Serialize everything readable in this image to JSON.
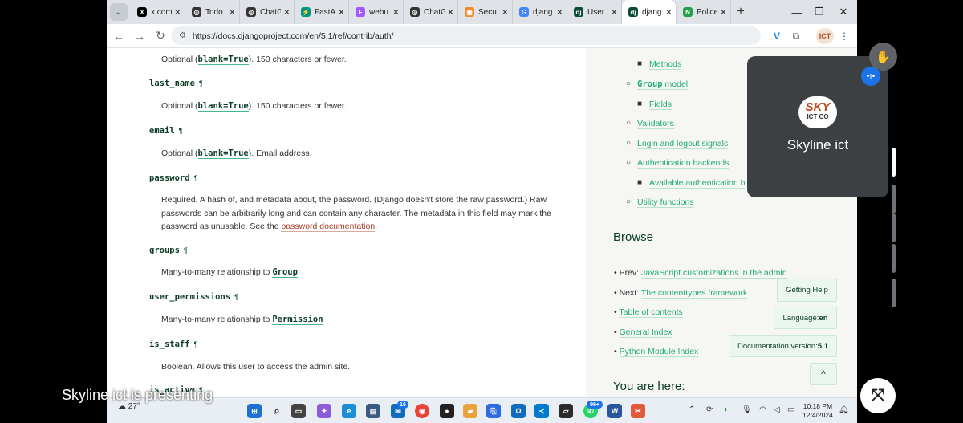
{
  "browser": {
    "tabs": [
      {
        "label": "x.com",
        "fav": "X",
        "color": "#000000"
      },
      {
        "label": "Todo",
        "fav": "◎",
        "color": "#333333"
      },
      {
        "label": "ChatG",
        "fav": "◎",
        "color": "#333333"
      },
      {
        "label": "FastA",
        "fav": "⚡",
        "color": "#009485"
      },
      {
        "label": "webu",
        "fav": "F",
        "color": "#a259ff"
      },
      {
        "label": "ChatG",
        "fav": "◎",
        "color": "#333333"
      },
      {
        "label": "Secu",
        "fav": "▣",
        "color": "#f08a24"
      },
      {
        "label": "djang",
        "fav": "G",
        "color": "#4285f4"
      },
      {
        "label": "User",
        "fav": "dj",
        "color": "#0c4b33"
      },
      {
        "label": "djang",
        "fav": "dj",
        "color": "#0c4b33"
      },
      {
        "label": "Police",
        "fav": "N",
        "color": "#24a148"
      }
    ],
    "active_tab_index": 9,
    "url": "https://docs.djangoproject.com/en/5.1/ref/contrib/auth/"
  },
  "doc": {
    "first_desc_pre": "Optional (",
    "first_desc_code": "blank=True",
    "first_desc_post": "). 150 characters or fewer.",
    "last_name": {
      "name": "last_name",
      "pre": "Optional (",
      "code": "blank=True",
      "post": "). 150 characters or fewer."
    },
    "email": {
      "name": "email",
      "pre": "Optional (",
      "code": "blank=True",
      "post": "). Email address."
    },
    "password": {
      "name": "password",
      "text": "Required. A hash of, and metadata about, the password. (Django doesn't store the raw password.) Raw passwords can be arbitrarily long and can contain any character. The metadata in this field may mark the password as unusable. See the ",
      "link": "password documentation",
      "post": "."
    },
    "groups": {
      "name": "groups",
      "pre": "Many-to-many relationship to ",
      "code": "Group"
    },
    "user_permissions": {
      "name": "user_permissions",
      "pre": "Many-to-many relationship to ",
      "code": "Permission"
    },
    "is_staff": {
      "name": "is_staff",
      "text": "Boolean. Allows this user to access the admin site."
    },
    "is_active": {
      "name": "is_active"
    },
    "pilcrow": "¶"
  },
  "sidebar": {
    "toc": {
      "methods": "Methods",
      "group_model_code": "Group",
      "group_model_text": " model",
      "fields": "Fields",
      "validators": "Validators",
      "login_logout": "Login and logout signals",
      "auth_backends": "Authentication backends",
      "available_backends": "Available authentication b",
      "utility": "Utility functions"
    },
    "browse_title": "Browse",
    "browse": {
      "prev_label": "Prev: ",
      "prev_link": "JavaScript customizations in the admin",
      "next_label": "Next: ",
      "next_link": "The contenttypes framework",
      "toc": "Table of contents",
      "general_index": "General Index",
      "module_index": "Python Module Index"
    },
    "you_are_here": "You are here:",
    "buttons": {
      "getting_help": "Getting Help",
      "language_label": "Language: ",
      "language_value": "en",
      "version_label": "Documentation version: ",
      "version_value": "5.1",
      "back_to_top": "^"
    }
  },
  "taskbar": {
    "weather": "27°",
    "badge_mail": "16",
    "badge_whatsapp": "99+",
    "clock_time": "10:18 PM",
    "clock_date": "12/4/2024"
  },
  "meet": {
    "presenter_name": "Skyline ict",
    "avatar_text": "SKY",
    "avatar_sub": "ICT CO",
    "presenting_text": "Skyline ict is presenting"
  }
}
